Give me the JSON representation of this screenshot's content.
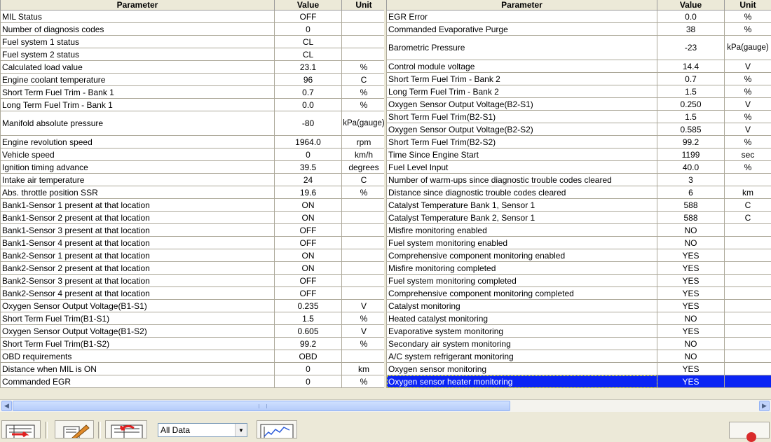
{
  "headers": {
    "parameter": "Parameter",
    "value": "Value",
    "unit": "Unit"
  },
  "left_rows": [
    {
      "p": "MIL Status",
      "v": "OFF",
      "u": ""
    },
    {
      "p": "Number of diagnosis codes",
      "v": "0",
      "u": ""
    },
    {
      "p": "Fuel system 1 status",
      "v": "CL",
      "u": ""
    },
    {
      "p": "Fuel system 2 status",
      "v": "CL",
      "u": ""
    },
    {
      "p": "Calculated load value",
      "v": "23.1",
      "u": "%"
    },
    {
      "p": "Engine coolant temperature",
      "v": "96",
      "u": "C"
    },
    {
      "p": "Short Term Fuel Trim - Bank 1",
      "v": "0.7",
      "u": "%"
    },
    {
      "p": "Long Term Fuel Trim - Bank 1",
      "v": "0.0",
      "u": "%"
    },
    {
      "p": "Manifold absolute pressure",
      "v": "-80",
      "u": "kPa(gauge)",
      "tall": true
    },
    {
      "p": "Engine revolution speed",
      "v": "1964.0",
      "u": "rpm"
    },
    {
      "p": "Vehicle speed",
      "v": "0",
      "u": "km/h"
    },
    {
      "p": "Ignition timing advance",
      "v": "39.5",
      "u": "degrees"
    },
    {
      "p": "Intake air temperature",
      "v": "24",
      "u": "C"
    },
    {
      "p": "Abs. throttle position SSR",
      "v": "19.6",
      "u": "%"
    },
    {
      "p": "Bank1-Sensor 1 present at that location",
      "v": "ON",
      "u": ""
    },
    {
      "p": "Bank1-Sensor 2 present at that location",
      "v": "ON",
      "u": ""
    },
    {
      "p": "Bank1-Sensor 3 present at that location",
      "v": "OFF",
      "u": ""
    },
    {
      "p": "Bank1-Sensor 4 present at that location",
      "v": "OFF",
      "u": ""
    },
    {
      "p": "Bank2-Sensor 1 present at that location",
      "v": "ON",
      "u": ""
    },
    {
      "p": "Bank2-Sensor 2 present at that location",
      "v": "ON",
      "u": ""
    },
    {
      "p": "Bank2-Sensor 3 present at that location",
      "v": "OFF",
      "u": ""
    },
    {
      "p": "Bank2-Sensor 4 present at that location",
      "v": "OFF",
      "u": ""
    },
    {
      "p": "Oxygen Sensor Output Voltage(B1-S1)",
      "v": "0.235",
      "u": "V"
    },
    {
      "p": "Short Term Fuel Trim(B1-S1)",
      "v": "1.5",
      "u": "%"
    },
    {
      "p": "Oxygen Sensor Output Voltage(B1-S2)",
      "v": "0.605",
      "u": "V"
    },
    {
      "p": "Short Term Fuel Trim(B1-S2)",
      "v": "99.2",
      "u": "%"
    },
    {
      "p": "OBD requirements",
      "v": "OBD",
      "u": ""
    },
    {
      "p": "Distance when MIL is ON",
      "v": "0",
      "u": "km"
    },
    {
      "p": "Commanded EGR",
      "v": "0",
      "u": "%"
    }
  ],
  "right_rows": [
    {
      "p": "EGR Error",
      "v": "0.0",
      "u": "%"
    },
    {
      "p": "Commanded Evaporative Purge",
      "v": "38",
      "u": "%"
    },
    {
      "p": "Barometric Pressure",
      "v": "-23",
      "u": "kPa(gauge)",
      "tall": true
    },
    {
      "p": "Control module voltage",
      "v": "14.4",
      "u": "V"
    },
    {
      "p": "Short Term Fuel Trim - Bank 2",
      "v": "0.7",
      "u": "%"
    },
    {
      "p": "Long Term Fuel Trim - Bank 2",
      "v": "1.5",
      "u": "%"
    },
    {
      "p": "Oxygen Sensor Output Voltage(B2-S1)",
      "v": "0.250",
      "u": "V"
    },
    {
      "p": "Short Term Fuel Trim(B2-S1)",
      "v": "1.5",
      "u": "%"
    },
    {
      "p": "Oxygen Sensor Output Voltage(B2-S2)",
      "v": "0.585",
      "u": "V"
    },
    {
      "p": "Short Term Fuel Trim(B2-S2)",
      "v": "99.2",
      "u": "%"
    },
    {
      "p": "Time Since Engine Start",
      "v": "1199",
      "u": "sec"
    },
    {
      "p": "Fuel Level Input",
      "v": "40.0",
      "u": "%"
    },
    {
      "p": "Number of warm-ups since diagnostic trouble codes cleared",
      "v": "3",
      "u": ""
    },
    {
      "p": "Distance since diagnostic trouble codes cleared",
      "v": "6",
      "u": "km"
    },
    {
      "p": "Catalyst Temperature Bank 1, Sensor 1",
      "v": "588",
      "u": "C"
    },
    {
      "p": "Catalyst Temperature Bank 2, Sensor 1",
      "v": "588",
      "u": "C"
    },
    {
      "p": "Misfire monitoring enabled",
      "v": "NO",
      "u": ""
    },
    {
      "p": "Fuel system monitoring enabled",
      "v": "NO",
      "u": ""
    },
    {
      "p": "Comprehensive component monitoring enabled",
      "v": "YES",
      "u": ""
    },
    {
      "p": "Misfire monitoring completed",
      "v": "YES",
      "u": ""
    },
    {
      "p": "Fuel system monitoring completed",
      "v": "YES",
      "u": ""
    },
    {
      "p": "Comprehensive component monitoring completed",
      "v": "YES",
      "u": ""
    },
    {
      "p": "Catalyst monitoring",
      "v": "YES",
      "u": ""
    },
    {
      "p": "Heated catalyst monitoring",
      "v": "NO",
      "u": ""
    },
    {
      "p": "Evaporative system monitoring",
      "v": "YES",
      "u": ""
    },
    {
      "p": "Secondary air system monitoring",
      "v": "NO",
      "u": ""
    },
    {
      "p": "A/C system refrigerant monitoring",
      "v": "NO",
      "u": ""
    },
    {
      "p": "Oxygen sensor monitoring",
      "v": "YES",
      "u": ""
    },
    {
      "p": "Oxygen sensor heater monitoring",
      "v": "YES",
      "u": "",
      "selected": true
    }
  ],
  "toolbar": {
    "data_filter": {
      "selected": "All Data"
    },
    "icons": [
      "export-list-icon",
      "sensor-tool-icon",
      "import-list-icon",
      "graph-icon",
      "record-icon"
    ]
  },
  "colors": {
    "selection": "#0a24f4",
    "frame": "#ece9d8"
  }
}
